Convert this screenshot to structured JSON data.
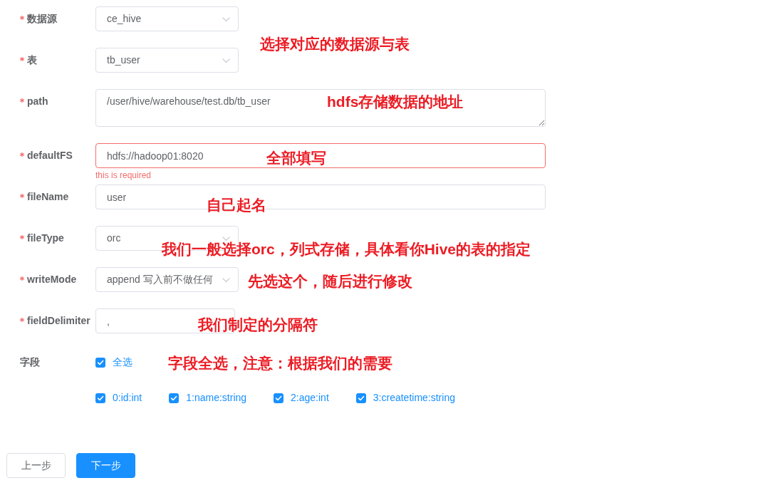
{
  "form": {
    "fields": [
      {
        "label": "数据源",
        "required": true,
        "kind": "select",
        "value": "ce_hive"
      },
      {
        "label": "表",
        "required": true,
        "kind": "select",
        "value": "tb_user"
      },
      {
        "label": "path",
        "required": true,
        "kind": "textarea",
        "value": "/user/hive/warehouse/test.db/tb_user"
      },
      {
        "label": "defaultFS",
        "required": true,
        "kind": "input",
        "value": "hdfs://hadoop01:8020",
        "error": "this is required"
      },
      {
        "label": "fileName",
        "required": true,
        "kind": "input",
        "value": "user"
      },
      {
        "label": "fileType",
        "required": true,
        "kind": "select",
        "value": "orc"
      },
      {
        "label": "writeMode",
        "required": true,
        "kind": "select",
        "value": "append 写入前不做任何"
      },
      {
        "label": "fieldDelimiter",
        "required": true,
        "kind": "short",
        "value": ","
      },
      {
        "label": "字段",
        "required": false,
        "kind": "checkboxes",
        "select_all": {
          "label": "全选",
          "checked": true
        },
        "options": [
          {
            "label": "0:id:int",
            "checked": true
          },
          {
            "label": "1:name:string",
            "checked": true
          },
          {
            "label": "2:age:int",
            "checked": true
          },
          {
            "label": "3:createtime:string",
            "checked": true
          }
        ]
      }
    ]
  },
  "buttons": [
    {
      "label": "上一步",
      "kind": "default"
    },
    {
      "label": "下一步",
      "kind": "primary"
    }
  ],
  "annotations": [
    "选择对应的数据源与表",
    "hdfs存储数据的地址",
    "全部填写",
    "自己起名",
    "我们一般选择orc，列式存储，具体看你Hive的表的指定",
    "先选这个，随后进行修改",
    "我们制定的分隔符",
    "字段全选，注意：根据我们的需要"
  ]
}
